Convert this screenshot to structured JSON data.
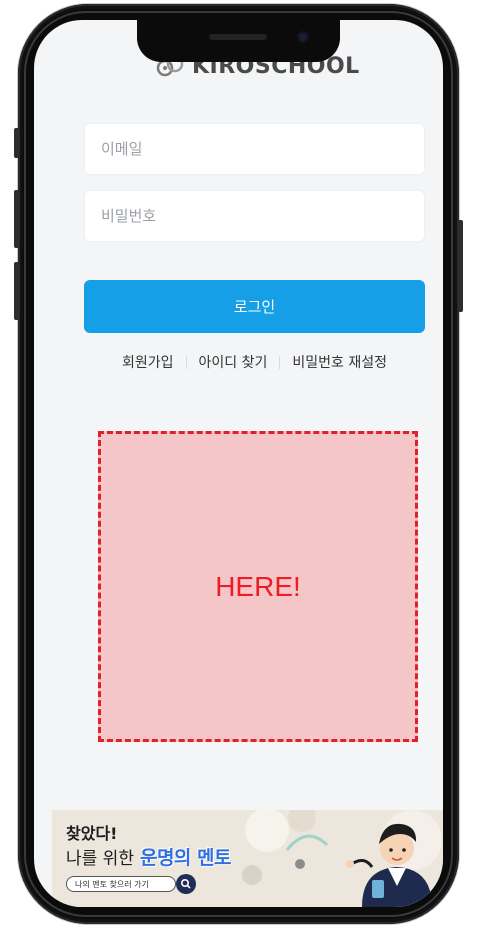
{
  "app": {
    "logo_text": "KIROSCHOOL"
  },
  "login_form": {
    "email_placeholder": "이메일",
    "password_placeholder": "비밀번호",
    "login_label": "로그인"
  },
  "links": {
    "signup": "회원가입",
    "find_id": "아이디 찾기",
    "reset_password": "비밀번호 재설정"
  },
  "placeholder_area": {
    "label": "HERE!"
  },
  "banner": {
    "line1": "찾았다!",
    "line2_prefix": "나를 위한",
    "line2_highlight": "운명의 멘토",
    "search_label": "나의 멘토 찾으러 가기"
  },
  "colors": {
    "brand_blue": "#149fe6",
    "highlight_red": "#ee1c24",
    "placeholder_fill": "#f4c6c8",
    "screen_background": "#f3f5f7"
  },
  "icons": {
    "logo": "kiro-logo-icon",
    "search": "search-icon",
    "mentor": "mentor-illustration-icon"
  }
}
